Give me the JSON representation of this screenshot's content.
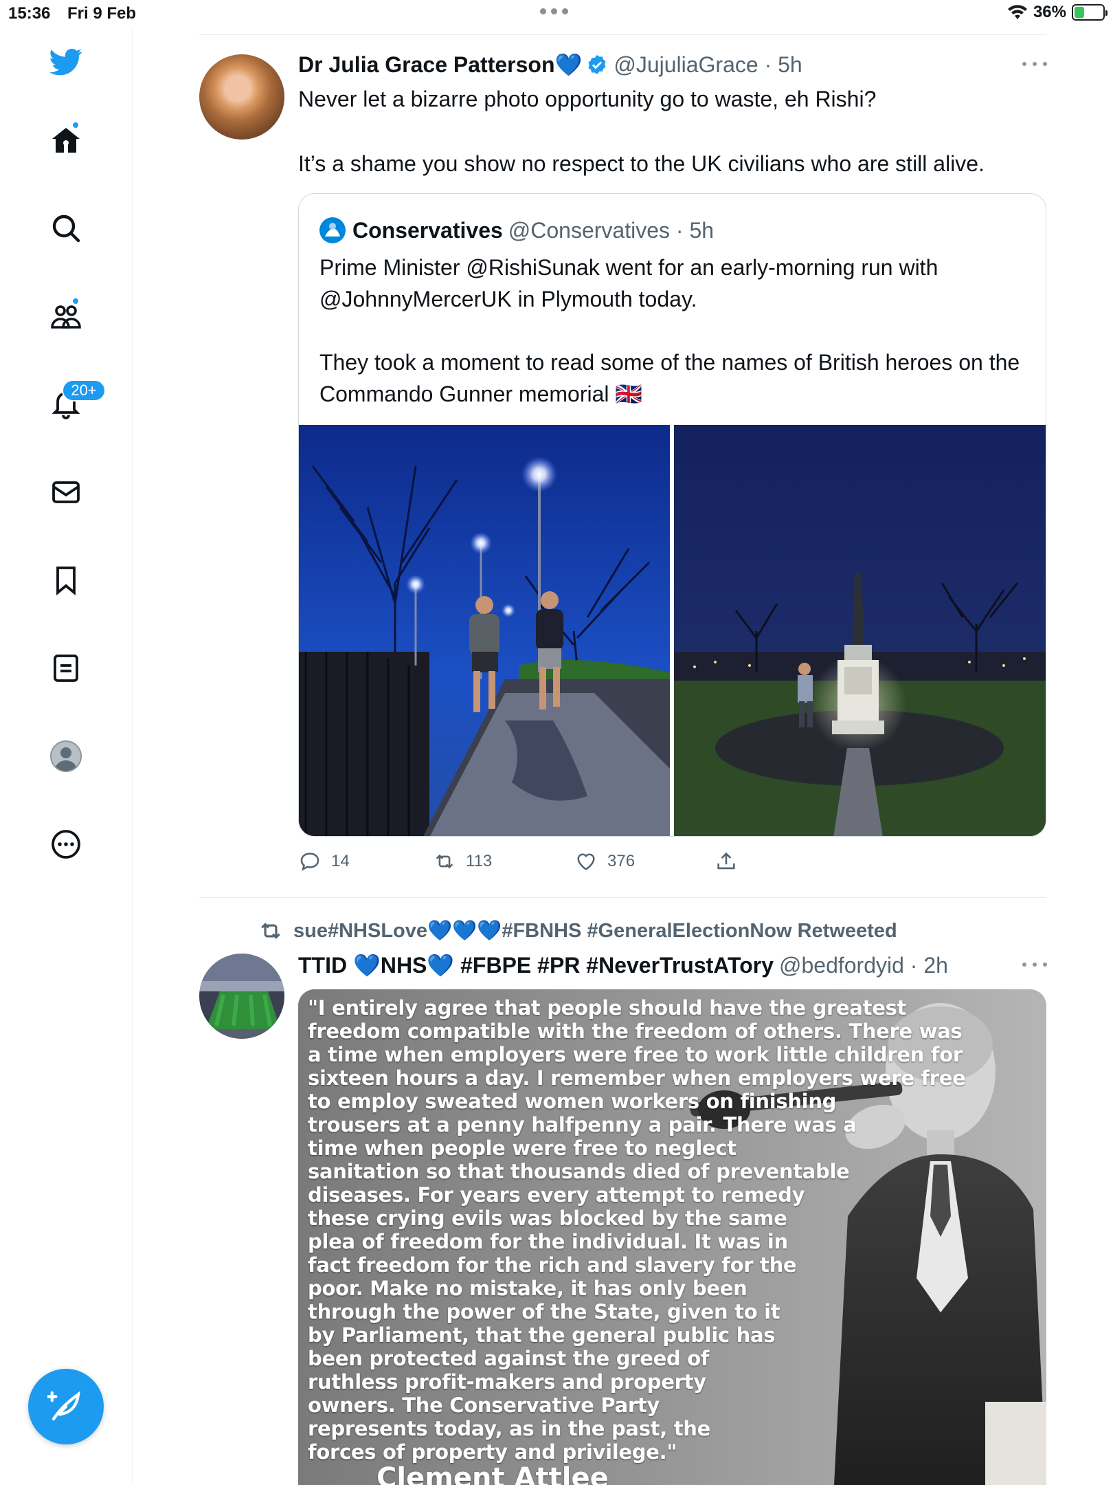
{
  "status_bar": {
    "time": "15:36",
    "date": "Fri 9 Feb",
    "battery": "36%",
    "battery_level": 0.36
  },
  "nav": {
    "icons": [
      "twitter-logo-icon",
      "home-icon",
      "search-icon",
      "communities-icon",
      "notifications-icon",
      "messages-icon",
      "bookmarks-icon",
      "lists-icon",
      "profile-icon",
      "more-icon"
    ],
    "notifications_badge": "20+",
    "compose_icon": "compose-tweet-icon"
  },
  "tweet1": {
    "name": "Dr Julia Grace Patterson",
    "name_emoji": "💙",
    "handle_time": "@JujuliaGrace · 5h",
    "text": "Never let a bizarre photo opportunity go to waste, eh Rishi?\n\nIt’s a shame you show no respect to the UK civilians who are still alive.",
    "quote": {
      "name": "Conservatives",
      "handle_time": "@Conservatives · 5h",
      "text": "Prime Minister @RishiSunak went for an early-morning run with @JohnnyMercerUK in Plymouth today.\n\nThey took a moment to read some of the names of British heroes on the Commando Gunner memorial 🇬🇧"
    },
    "actions": {
      "replies": "14",
      "retweets": "113",
      "likes": "376"
    }
  },
  "tweet2": {
    "retweeted_by": "sue#NHSLove💙💙💙#FBNHS #GeneralElectionNow Retweeted",
    "name": "TTID 💙NHS💙 #FBPE #PR #NeverTrustATory",
    "handle_time": "@bedfordyid · 2h",
    "image_quote_lines": [
      "\"I entirely agree that people should have the greatest",
      "freedom compatible with the freedom of others. There was",
      "a time when employers were free to work little children for",
      "sixteen hours a day. I remember when employers were free",
      "to employ sweated women workers on finishing",
      "trousers at a penny halfpenny a pair. There was a",
      "time when people were free to neglect",
      "sanitation so that thousands died of preventable",
      "diseases. For years every attempt to remedy",
      "these crying evils was blocked by the same",
      "plea of freedom for the individual. It was in",
      "fact freedom for the rich and slavery for the",
      "poor. Make no mistake, it has only been",
      "through the power of the State, given to it",
      "by Parliament, that the general public has",
      "been protected against the greed of",
      "ruthless profit-makers and property",
      "owners. The Conservative Party",
      "represents today, as in the past, the",
      "forces of property and privilege.\""
    ],
    "image_attribution": "Clement Attlee"
  }
}
